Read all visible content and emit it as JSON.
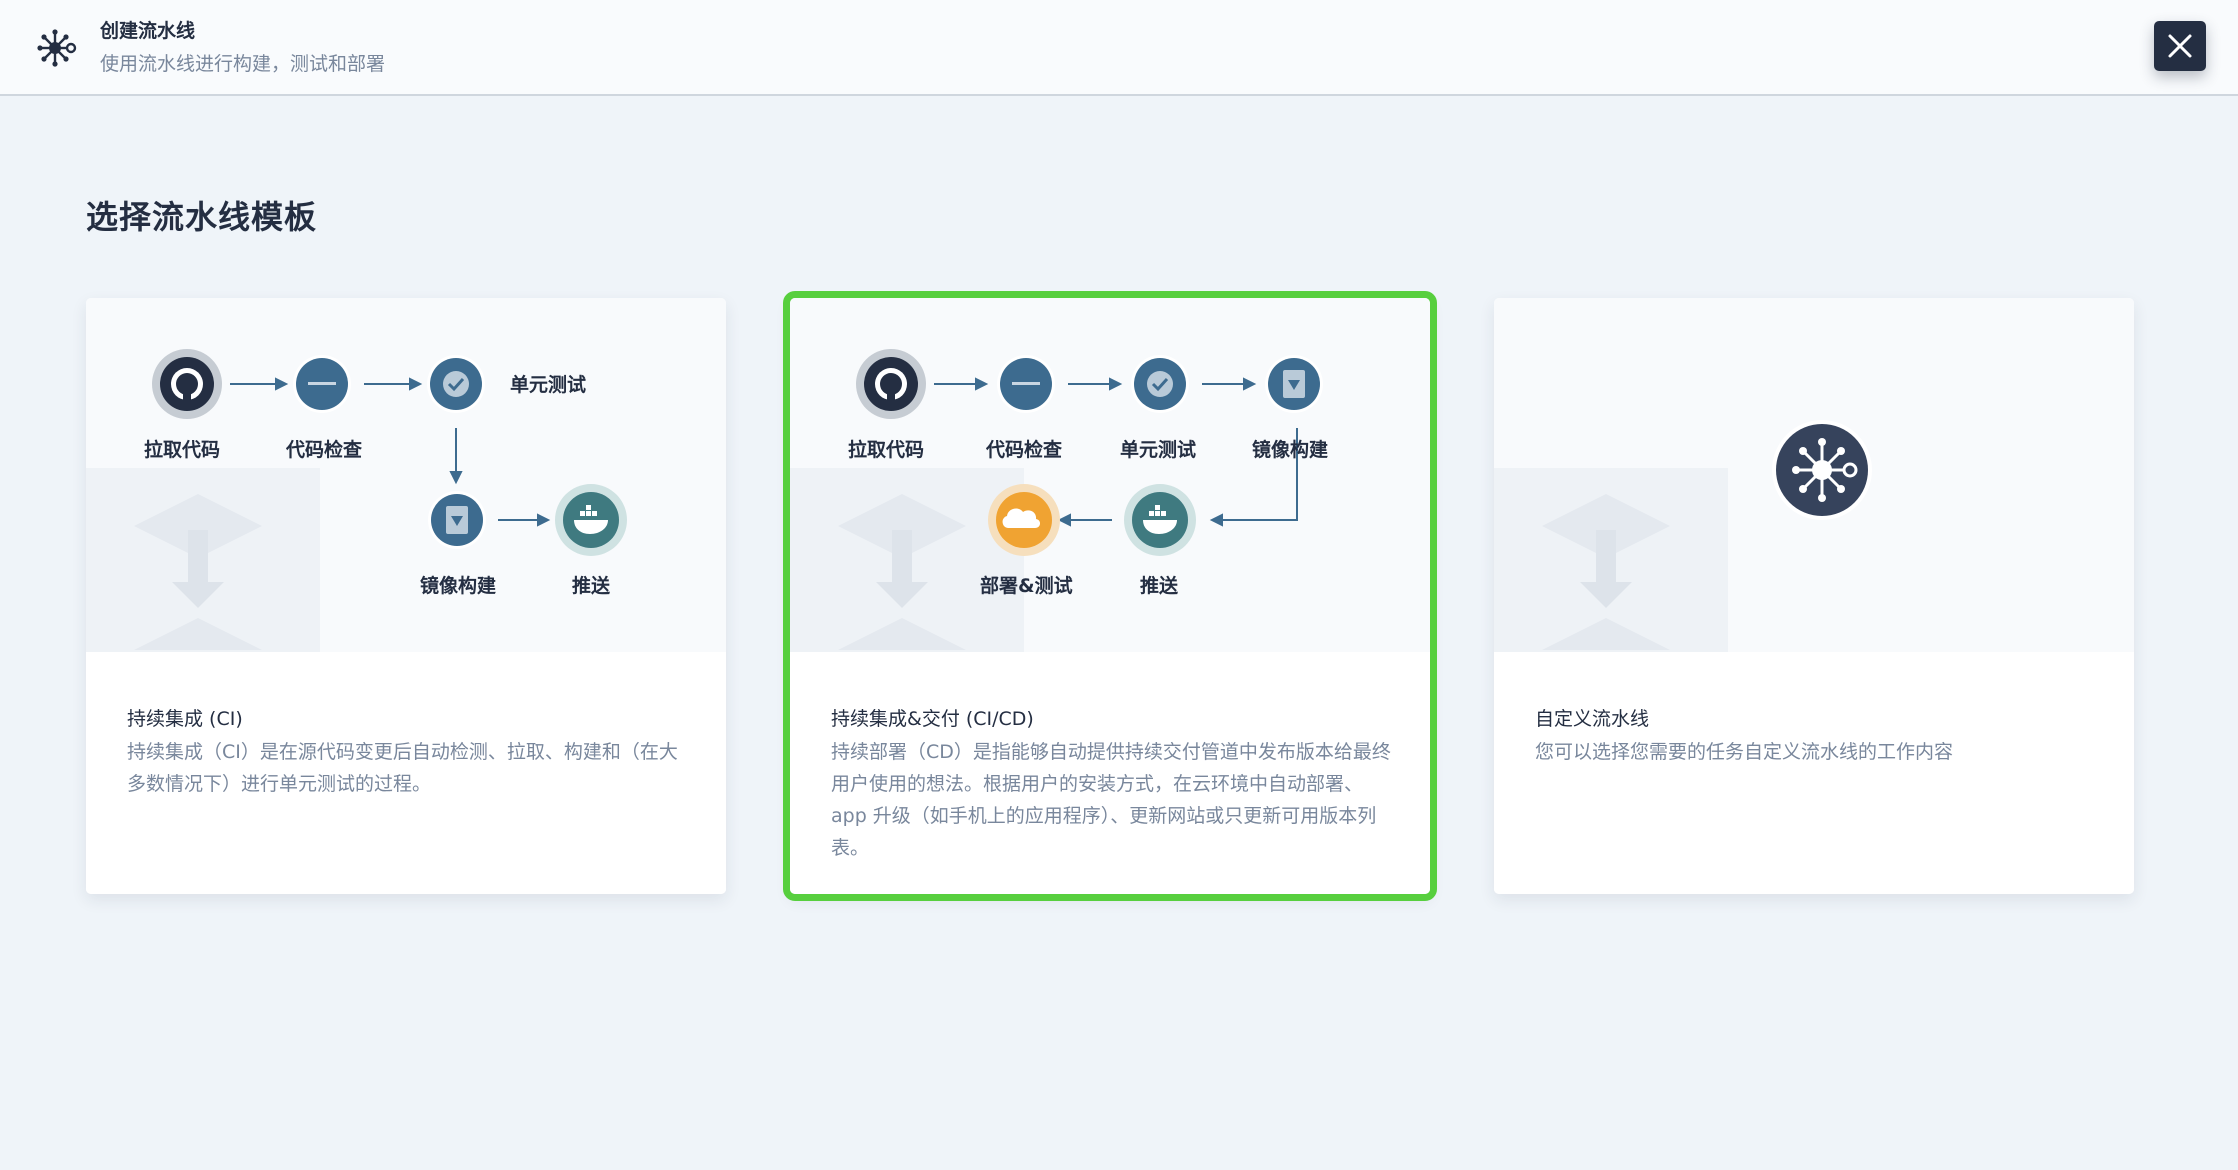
{
  "header": {
    "title": "创建流水线",
    "subtitle": "使用流水线进行构建，测试和部署"
  },
  "section_title": "选择流水线模板",
  "cards": [
    {
      "name": "持续集成 (CI)",
      "description": "持续集成（CI）是在源代码变更后自动检测、拉取、构建和（在大多数情况下）进行单元测试的过程。",
      "steps": [
        "拉取代码",
        "代码检查",
        "单元测试",
        "镜像构建",
        "推送"
      ],
      "selected": false
    },
    {
      "name": "持续集成&交付 (CI/CD)",
      "description": "持续部署（CD）是指能够自动提供持续交付管道中发布版本给最终用户使用的想法。根据用户的安装方式，在云环境中自动部署、app 升级（如手机上的应用程序）、更新网站或只更新可用版本列表。",
      "steps": [
        "拉取代码",
        "代码检查",
        "单元测试",
        "镜像构建",
        "推送",
        "部署&测试"
      ],
      "selected": true
    },
    {
      "name": "自定义流水线",
      "description": "您可以选择您需要的任务自定义流水线的工作内容",
      "steps": [],
      "selected": false
    }
  ],
  "colors": {
    "selected_border": "#57cf3e",
    "dark": "#242e42",
    "step_blue": "#3d6b8f",
    "deploy_orange": "#f0a332",
    "muted_text": "#79879c"
  },
  "icons": [
    "pipeline-icon",
    "close-icon",
    "github-icon",
    "sonarqube-icon",
    "check-icon",
    "image-build-icon",
    "docker-icon",
    "cloud-icon"
  ]
}
